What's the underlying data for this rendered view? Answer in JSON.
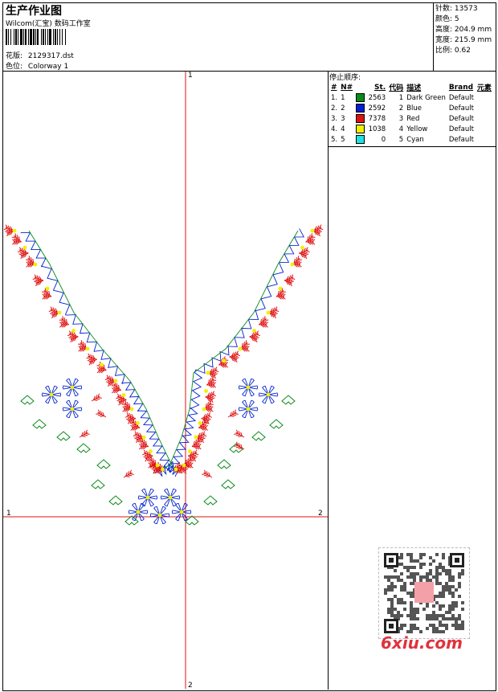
{
  "header": {
    "title": "生产作业图",
    "company": "Wilcom(汇宝) 数码工作室",
    "design_label": "花版:",
    "design_file": "2129317.dst",
    "colorway_label": "色位:",
    "colorway": "Colorway 1"
  },
  "stats": {
    "stitches_label": "针数:",
    "stitches": "13573",
    "colors_label": "颜色:",
    "colors": "5",
    "height_label": "高度:",
    "height": "204.9 mm",
    "width_label": "宽度:",
    "width": "215.9 mm",
    "scale_label": "比例:",
    "scale": "0.62"
  },
  "stop_sequence": {
    "title": "停止顺序:",
    "headers": [
      "#",
      "N#",
      "St.",
      "代码",
      "描述",
      "Brand",
      "元素"
    ],
    "rows": [
      {
        "idx": "1.",
        "n": "1",
        "color": "#0a8a1a",
        "st": "2563",
        "code": "1",
        "desc": "Dark Green",
        "brand": "Default"
      },
      {
        "idx": "2.",
        "n": "2",
        "color": "#0020d0",
        "st": "2592",
        "code": "2",
        "desc": "Blue",
        "brand": "Default"
      },
      {
        "idx": "3.",
        "n": "3",
        "color": "#e01010",
        "st": "7378",
        "code": "3",
        "desc": "Red",
        "brand": "Default"
      },
      {
        "idx": "4.",
        "n": "4",
        "color": "#f0f000",
        "st": "1038",
        "code": "4",
        "desc": "Yellow",
        "brand": "Default"
      },
      {
        "idx": "5.",
        "n": "5",
        "color": "#20e0e0",
        "st": "0",
        "code": "5",
        "desc": "Cyan",
        "brand": "Default"
      }
    ]
  },
  "axes": {
    "top_label": "1",
    "bottom_label": "2",
    "left_label": "1",
    "right_label": "2"
  },
  "watermark": {
    "text": "6xiu.com"
  },
  "colors": {
    "dark_green": "#0a8a1a",
    "blue": "#0020d0",
    "red": "#e01010",
    "yellow": "#f0f000",
    "axis_red": "#e01010"
  }
}
